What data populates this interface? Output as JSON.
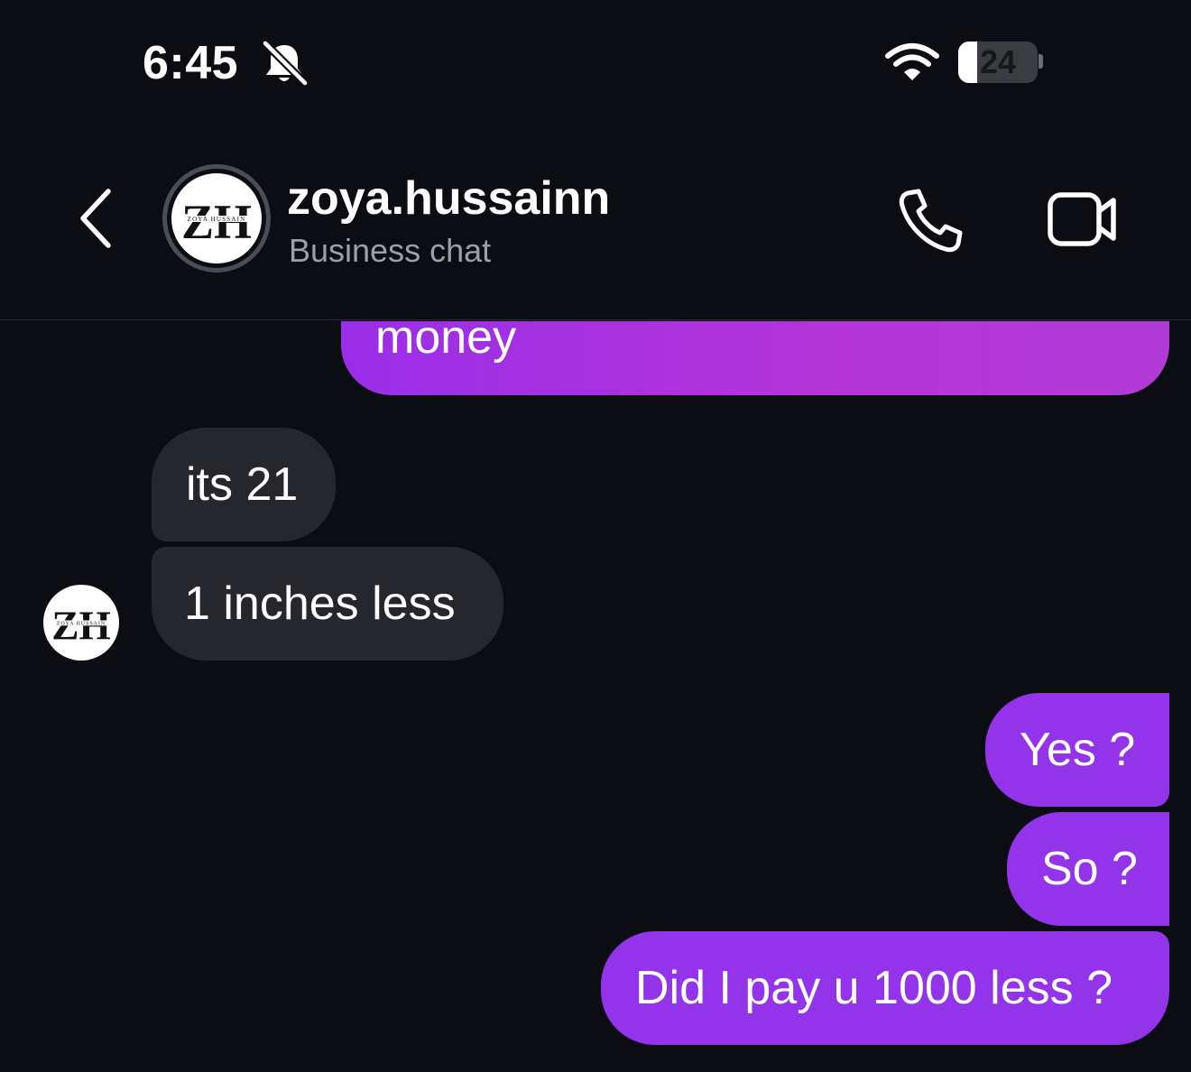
{
  "status_bar": {
    "time": "6:45",
    "battery_level": "24",
    "battery_fraction": 0.24,
    "icons": [
      "bell-slash-icon",
      "wifi-icon",
      "battery-icon"
    ]
  },
  "header": {
    "name": "zoya.hussainn",
    "subtitle": "Business chat",
    "avatar_monogram": "ZH",
    "avatar_wordmark": "ZOYA HUSSAIN",
    "icons": [
      "back-chevron-icon",
      "phone-icon",
      "video-camera-icon"
    ]
  },
  "messages": [
    {
      "direction": "outgoing",
      "text": "money"
    },
    {
      "direction": "incoming",
      "text": "its 21"
    },
    {
      "direction": "incoming",
      "text": "1 inches less"
    },
    {
      "direction": "outgoing",
      "text": "Yes ?"
    },
    {
      "direction": "outgoing",
      "text": "So ?"
    },
    {
      "direction": "outgoing",
      "text": "Did I pay u 1000 less ?"
    }
  ],
  "colors": {
    "background": "#0b0d12",
    "outgoing_bubble": "#9333ea",
    "incoming_bubble": "#25272d",
    "subtitle_text": "#9aa0a9"
  }
}
